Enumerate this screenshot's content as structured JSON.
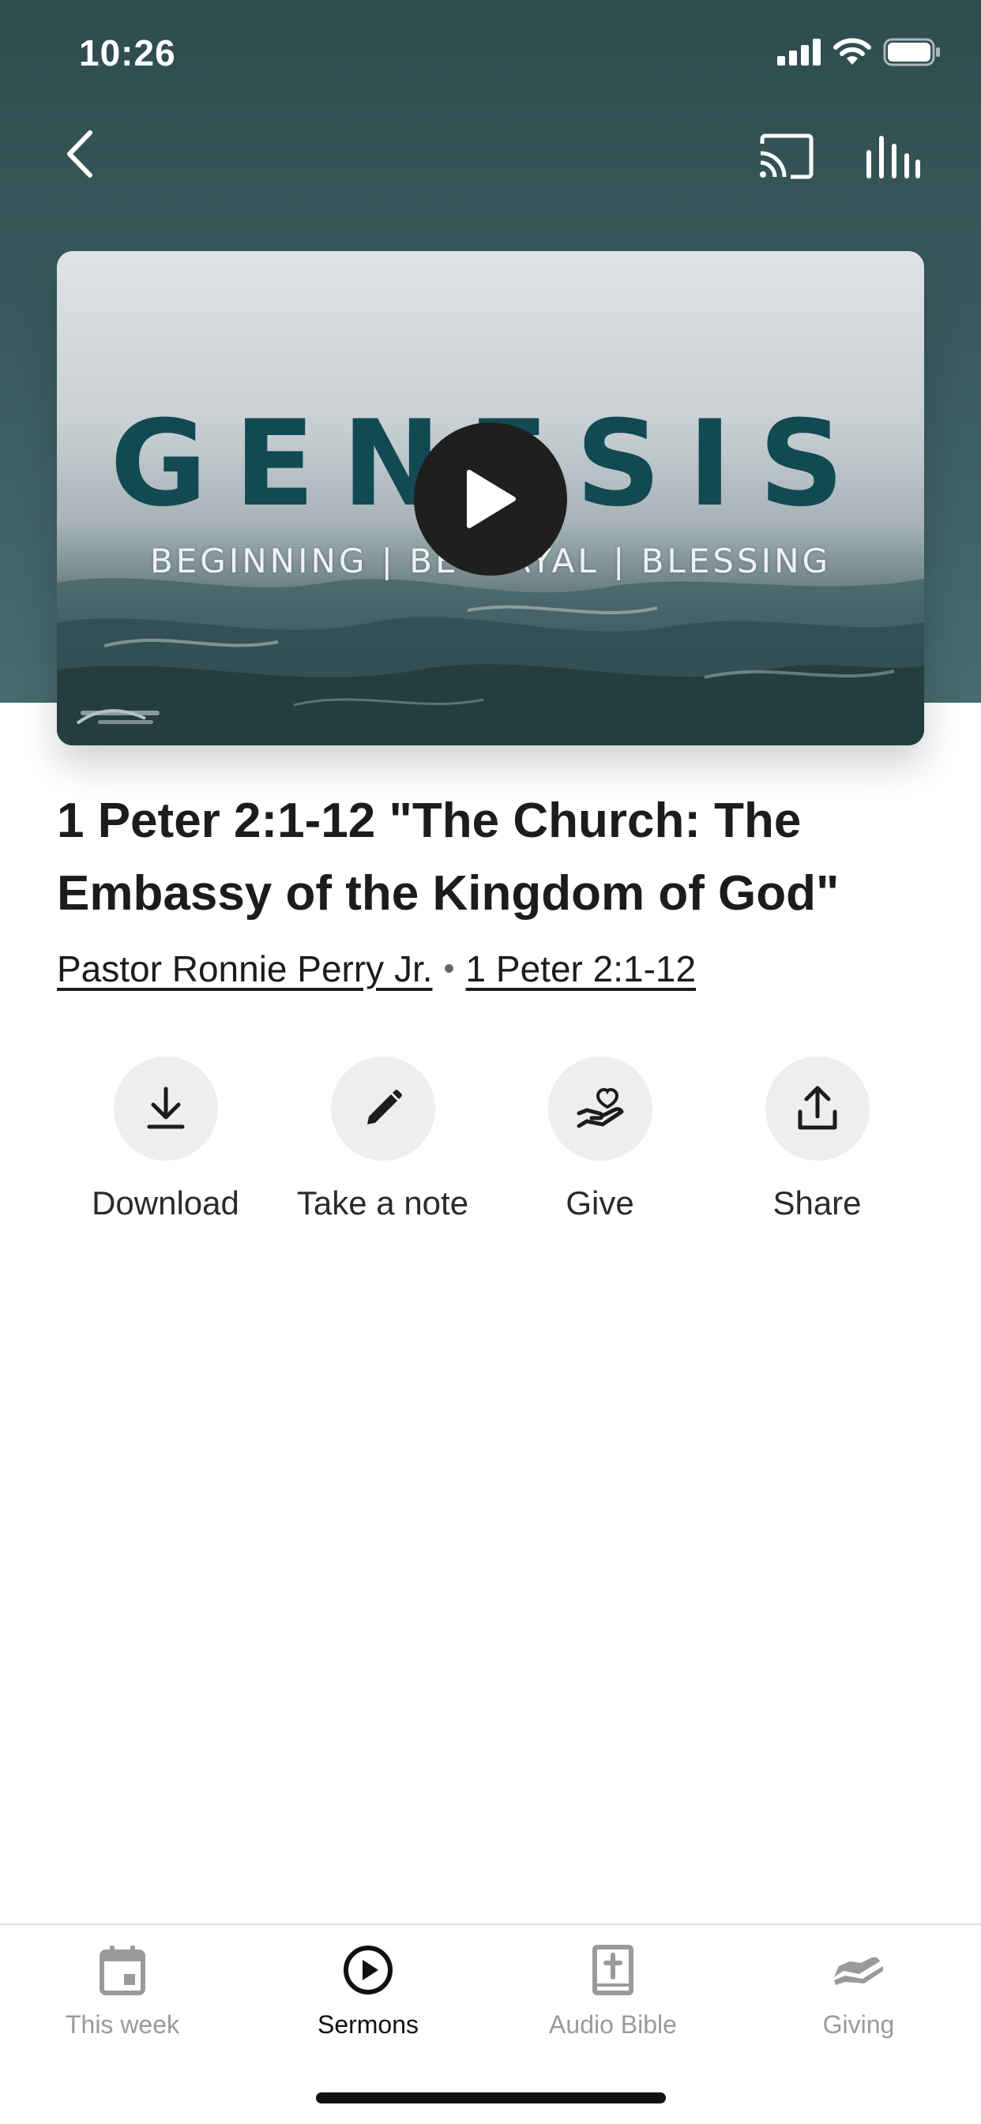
{
  "status_bar": {
    "time": "10:26",
    "icons": [
      "cellular-signal-icon",
      "wifi-icon",
      "battery-icon"
    ]
  },
  "header": {
    "back_icon": "chevron-left-icon",
    "cast_icon": "cast-icon",
    "audio_icon": "audio-bars-icon",
    "background_color": "#3b5d60"
  },
  "thumbnail": {
    "title": "GENESIS",
    "subtitle": "BEGINNING | BETRAYAL | BLESSING",
    "play_icon": "play-icon"
  },
  "sermon": {
    "title": "1 Peter 2:1-12 \"The Church: The Embassy of the Kingdom of God\"",
    "speaker": "Pastor Ronnie Perry Jr.",
    "separator": "•",
    "scripture": "1 Peter 2:1-12"
  },
  "actions": [
    {
      "label": "Download",
      "icon": "download-icon"
    },
    {
      "label": "Take a note",
      "icon": "pencil-icon"
    },
    {
      "label": "Give",
      "icon": "heart-hand-icon"
    },
    {
      "label": "Share",
      "icon": "share-icon"
    }
  ],
  "tab_bar": {
    "tabs": [
      {
        "label": "This week",
        "icon": "calendar-icon",
        "active": false
      },
      {
        "label": "Sermons",
        "icon": "play-circle-icon",
        "active": true
      },
      {
        "label": "Audio Bible",
        "icon": "bible-icon",
        "active": false
      },
      {
        "label": "Giving",
        "icon": "giving-hand-icon",
        "active": false
      }
    ]
  },
  "colors": {
    "active_tab": "#111111",
    "inactive_tab": "#9a9a9a",
    "action_circle": "#edeef0"
  }
}
